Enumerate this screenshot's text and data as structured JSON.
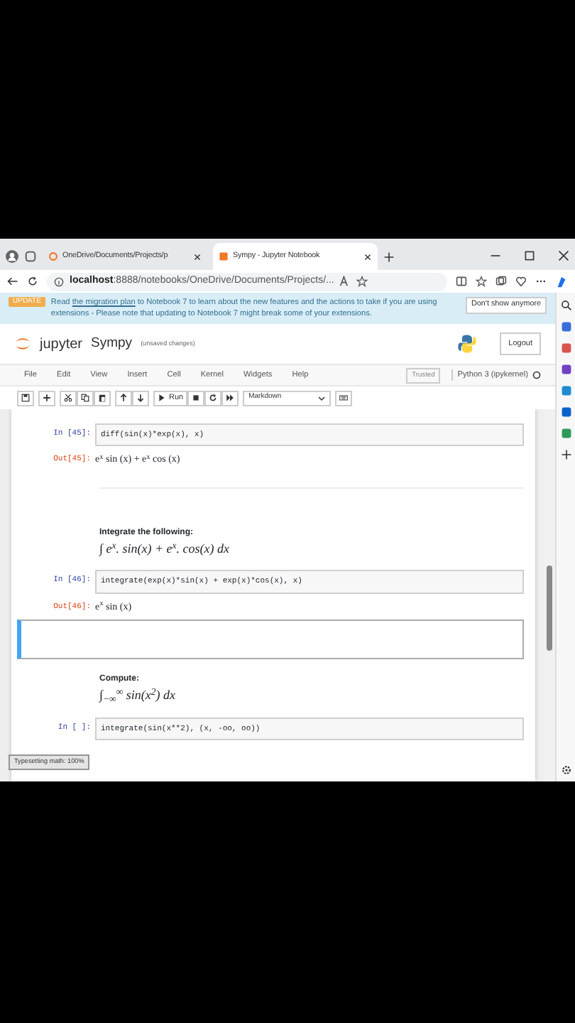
{
  "browser": {
    "tabs": [
      {
        "title": "OneDrive/Documents/Projects/p",
        "selected": false
      },
      {
        "title": "Sympy - Jupyter Notebook",
        "selected": true
      }
    ],
    "address": {
      "host": "localhost",
      "rest": ":8888/notebooks/OneDrive/Documents/Projects/..."
    }
  },
  "banner": {
    "badge": "UPDATE",
    "text_before": "Read ",
    "link": "the migration plan",
    "text_after": " to Notebook 7 to learn about the new features and the actions to take if you are using extensions - Please note that updating to Notebook 7 might break some of your extensions.",
    "button": "Don't show anymore"
  },
  "header": {
    "logo": "jupyter",
    "title": "Sympy",
    "status": "(unsaved changes)",
    "logout": "Logout"
  },
  "menu": {
    "items": [
      "File",
      "Edit",
      "View",
      "Insert",
      "Cell",
      "Kernel",
      "Widgets",
      "Help"
    ],
    "trusted": "Trusted",
    "kernel": "Python 3 (ipykernel)"
  },
  "toolbar": {
    "run": "Run",
    "cell_type": "Markdown"
  },
  "cells": [
    {
      "kind": "code",
      "prompt": "In [45]:",
      "source": "diff(sin(x)*exp(x), x)",
      "out_prompt": "Out[45]:",
      "output": "e$^{x}$ sin (x) + e$^{x}$ cos (x)"
    },
    {
      "kind": "markdown",
      "heading": "Integrate the following:",
      "math": "∫ e$^{x}$. sin(x) + e$^{x}$. cos(x) dx"
    },
    {
      "kind": "code",
      "prompt": "In [46]:",
      "source": "integrate(exp(x)*sin(x) + exp(x)*cos(x), x)",
      "out_prompt": "Out[46]:",
      "output": "e$^{x}$ sin (x)"
    },
    {
      "kind": "empty",
      "selected": true
    },
    {
      "kind": "markdown",
      "heading": "Compute:",
      "math": "∫$_{−∞}$$^{∞}$ sin(x$^{2}$) dx"
    },
    {
      "kind": "code",
      "prompt": "In [ ]:",
      "source": "integrate(sin(x**2), (x, -oo, oo))"
    }
  ],
  "status": "Typesetting math: 100%"
}
